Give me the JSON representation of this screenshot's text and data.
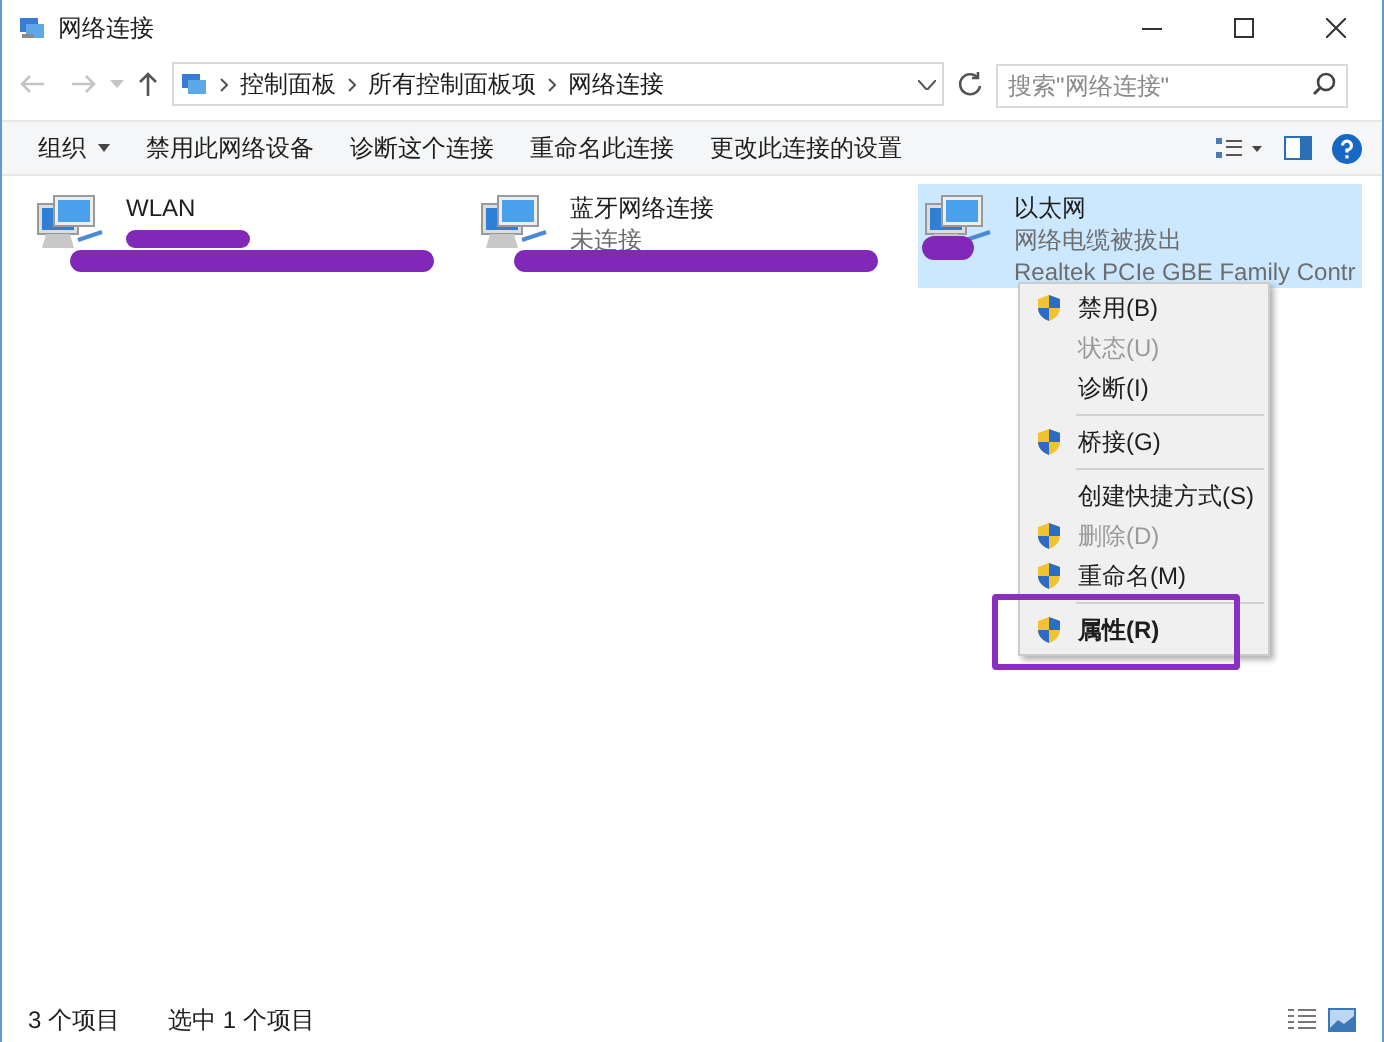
{
  "window": {
    "title": "网络连接"
  },
  "address_bar": {
    "breadcrumb": [
      "控制面板",
      "所有控制面板项",
      "网络连接"
    ]
  },
  "search": {
    "placeholder": "搜索\"网络连接\""
  },
  "toolbar": [
    {
      "label": "组织",
      "dropdown": true
    },
    {
      "label": "禁用此网络设备",
      "dropdown": false
    },
    {
      "label": "诊断这个连接",
      "dropdown": false
    },
    {
      "label": "重命名此连接",
      "dropdown": false
    },
    {
      "label": "更改此连接的设置",
      "dropdown": false
    }
  ],
  "connections": [
    {
      "name": "WLAN",
      "status_redacted": true,
      "detail_redacted": true,
      "icon_redacted": false,
      "selected": false
    },
    {
      "name": "蓝牙网络连接",
      "status": "未连接",
      "status_redacted": false,
      "detail_redacted": true,
      "icon_redacted": false,
      "selected": false
    },
    {
      "name": "以太网",
      "status": "网络电缆被拔出",
      "detail": "Realtek PCIe GBE Family Contr",
      "status_redacted": false,
      "detail_redacted": false,
      "icon_redacted": true,
      "selected": true
    }
  ],
  "context_menu": [
    {
      "kind": "item",
      "label": "禁用(B)",
      "shield": true,
      "disabled": false,
      "bold": false,
      "annotated": false
    },
    {
      "kind": "item",
      "label": "状态(U)",
      "shield": false,
      "disabled": true,
      "bold": false,
      "annotated": false
    },
    {
      "kind": "item",
      "label": "诊断(I)",
      "shield": false,
      "disabled": false,
      "bold": false,
      "annotated": false
    },
    {
      "kind": "separator"
    },
    {
      "kind": "item",
      "label": "桥接(G)",
      "shield": true,
      "disabled": false,
      "bold": false,
      "annotated": false
    },
    {
      "kind": "separator"
    },
    {
      "kind": "item",
      "label": "创建快捷方式(S)",
      "shield": false,
      "disabled": false,
      "bold": false,
      "annotated": false
    },
    {
      "kind": "item",
      "label": "删除(D)",
      "shield": true,
      "disabled": true,
      "bold": false,
      "annotated": false
    },
    {
      "kind": "item",
      "label": "重命名(M)",
      "shield": true,
      "disabled": false,
      "bold": false,
      "annotated": false
    },
    {
      "kind": "separator"
    },
    {
      "kind": "item",
      "label": "属性(R)",
      "shield": true,
      "disabled": false,
      "bold": true,
      "annotated": true
    }
  ],
  "status_bar": [
    "3 个项目",
    "选中 1 个项目"
  ]
}
